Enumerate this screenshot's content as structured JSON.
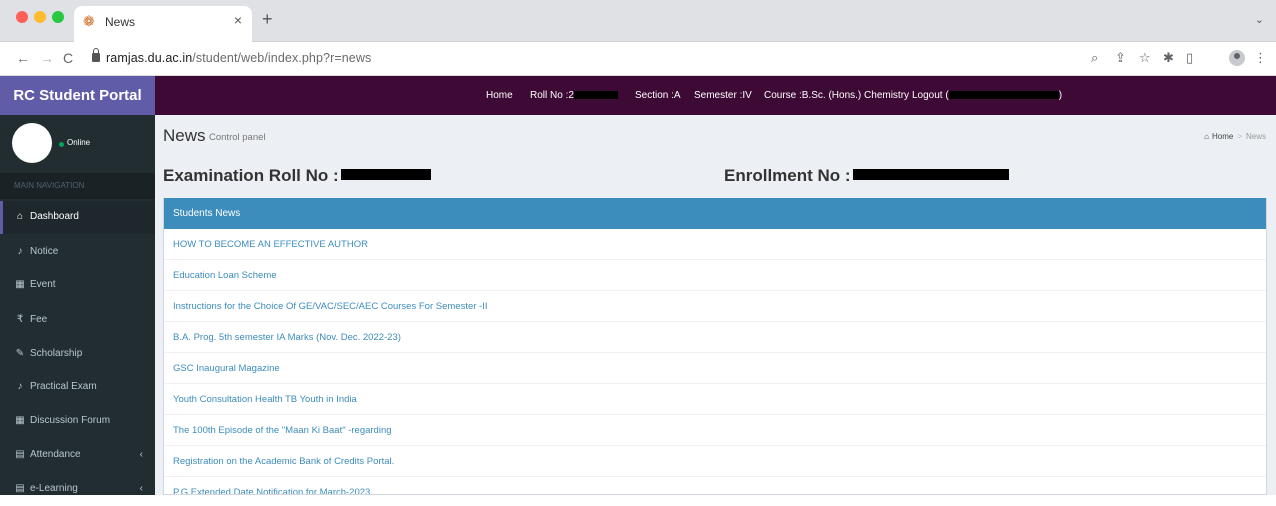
{
  "browser": {
    "tab_title": "News",
    "url_host": "ramjas.du.ac.in",
    "url_path": "/student/web/index.php?r=news"
  },
  "header": {
    "brand": "RC Student Portal",
    "nav": {
      "home": "Home",
      "roll_no": "Roll No :2",
      "section": "Section :A",
      "semester": "Semester :IV",
      "course": "Course :B.Sc. (Hons.) Chemistry",
      "logout": "Logout ("
    }
  },
  "sidebar": {
    "status": "Online",
    "nav_header": "MAIN NAVIGATION",
    "items": [
      {
        "label": "Dashboard",
        "icon": "dashboard-icon"
      },
      {
        "label": "Notice",
        "icon": "bell-icon"
      },
      {
        "label": "Event",
        "icon": "calendar-icon"
      },
      {
        "label": "Fee",
        "icon": "rupee-icon"
      },
      {
        "label": "Scholarship",
        "icon": "wrench-icon"
      },
      {
        "label": "Practical Exam",
        "icon": "bell-icon"
      },
      {
        "label": "Discussion Forum",
        "icon": "calendar-icon"
      },
      {
        "label": "Attendance",
        "icon": "book-icon"
      },
      {
        "label": "e-Learning",
        "icon": "book-icon"
      }
    ]
  },
  "content": {
    "title": "News",
    "subtitle": "Control panel",
    "breadcrumb": {
      "home": "Home",
      "current": "News"
    },
    "exam_roll_label": "Examination Roll No :",
    "enrollment_label": "Enrollment No :"
  },
  "news": {
    "header": "Students News",
    "items": [
      "HOW TO BECOME AN EFFECTIVE AUTHOR",
      "Education Loan Scheme",
      "Instructions for the Choice Of GE/VAC/SEC/AEC Courses For Semester -II",
      "B.A. Prog. 5th semester IA Marks (Nov. Dec. 2022-23)",
      "GSC Inaugural Magazine",
      "Youth Consultation Health TB Youth in India",
      "The 100th Episode of the \"Maan Ki Baat\" -regarding",
      "Registration on the Academic Bank of Credits Portal.",
      "P.G Extended Date Notification for March-2023"
    ]
  },
  "colors": {
    "brand": "#605ca8",
    "topnav": "#3d0a35",
    "sidebar": "#222d32",
    "news_header": "#3c8dbc",
    "link": "#3c8dbc",
    "online": "#00a65a"
  }
}
